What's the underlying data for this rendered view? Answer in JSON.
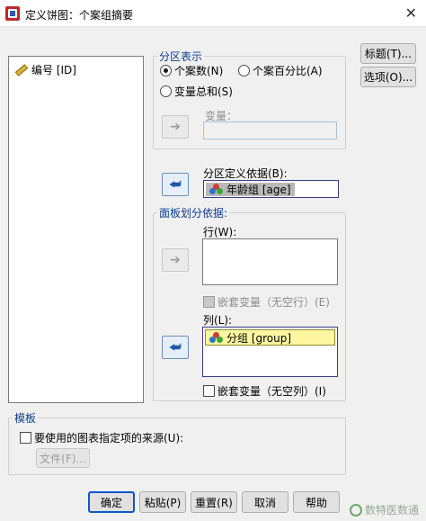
{
  "window": {
    "title": "定义饼图：个案组摘要"
  },
  "variable_list": {
    "items": [
      {
        "label": "编号 [ID]",
        "icon": "ruler-icon"
      }
    ]
  },
  "slice_represent": {
    "legend": "分区表示",
    "options": [
      {
        "label": "个案数(N)",
        "selected": true
      },
      {
        "label": "个案百分比(A)",
        "selected": false
      },
      {
        "label": "变量总和(S)",
        "selected": false
      }
    ],
    "variable_label": "变量："
  },
  "slice_define": {
    "label": "分区定义依据(B):",
    "value": "年龄组 [age]"
  },
  "panel_by": {
    "legend": "面板划分依据:",
    "rows_label": "行(W):",
    "nest_rows_label": "嵌套变量（无空行）(E)",
    "cols_label": "列(L):",
    "cols_value": "分组 [group]",
    "nest_cols_label": "嵌套变量（无空列）(I)"
  },
  "template": {
    "legend": "模板",
    "use_chart_spec_label": "要使用的图表指定项的来源(U):",
    "file_button": "文件(F)..."
  },
  "side_buttons": {
    "titles": "标题(T)...",
    "options": "选项(O)..."
  },
  "footer_buttons": {
    "ok": "确定",
    "paste": "粘贴(P)",
    "reset": "重置(R)",
    "cancel": "取消",
    "help": "帮助"
  },
  "watermark": {
    "text": "数特医数通"
  }
}
